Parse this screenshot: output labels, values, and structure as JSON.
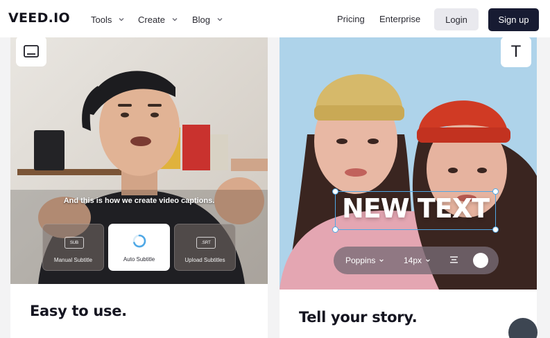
{
  "nav": {
    "logo": "VEED.IO",
    "menus": [
      "Tools",
      "Create",
      "Blog"
    ],
    "pricing": "Pricing",
    "enterprise": "Enterprise",
    "login": "Login",
    "signup": "Sign up"
  },
  "left_card": {
    "caption": "And this is how we create video captions.",
    "options": [
      {
        "label": "Manual Subtitle",
        "tag": "SUB"
      },
      {
        "label": "Auto Subtitle"
      },
      {
        "label": "Upload Subtitles",
        "tag": ".SRT"
      }
    ],
    "title": "Easy to use.",
    "badge_icon": "subtitle-icon"
  },
  "right_card": {
    "overlay_text": "NEW TEXT",
    "font": "Poppins",
    "size": "14px",
    "title": "Tell your story.",
    "badge_label": "T",
    "badge_icon": "text-icon"
  },
  "colors": {
    "accent_dark": "#171b32",
    "selection": "#4fa8e6"
  }
}
